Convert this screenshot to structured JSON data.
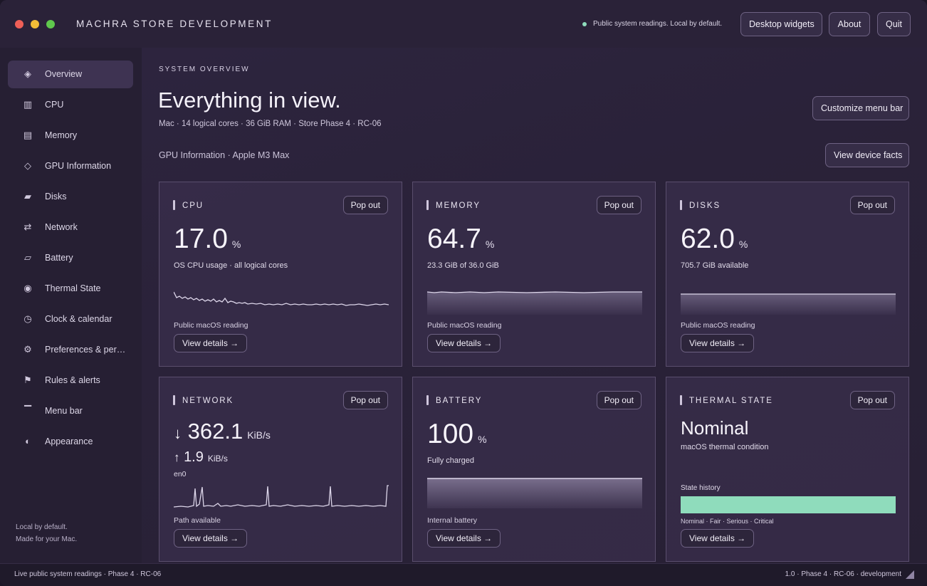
{
  "app": {
    "title": "MACHRA STORE DEVELOPMENT",
    "status": "Public system readings. Local by default.",
    "buttons": {
      "widgets": "Desktop widgets",
      "about": "About",
      "quit": "Quit"
    }
  },
  "sidebar": {
    "items": [
      {
        "label": "Overview",
        "icon": "◈"
      },
      {
        "label": "CPU",
        "icon": "▥"
      },
      {
        "label": "Memory",
        "icon": "▤"
      },
      {
        "label": "GPU Information",
        "icon": "◇"
      },
      {
        "label": "Disks",
        "icon": "▰"
      },
      {
        "label": "Network",
        "icon": "⇄"
      },
      {
        "label": "Battery",
        "icon": "▱"
      },
      {
        "label": "Thermal State",
        "icon": "◉"
      },
      {
        "label": "Clock & calendar",
        "icon": "◷"
      },
      {
        "label": "Preferences & per…",
        "icon": "⚙"
      },
      {
        "label": "Rules & alerts",
        "icon": "⚑"
      },
      {
        "label": "Menu bar",
        "icon": "▔"
      },
      {
        "label": "Appearance",
        "icon": "◐"
      }
    ],
    "footer_line1": "Local by default.",
    "footer_line2": "Made for your Mac."
  },
  "overview": {
    "eyebrow": "SYSTEM OVERVIEW",
    "headline": "Everything in view.",
    "subline": "Mac · 14 logical cores · 36 GiB RAM  ·  Store Phase 4 · RC-06",
    "gpu_line": "GPU Information · Apple M3 Max",
    "customize": "Customize menu bar",
    "device_facts": "View device facts"
  },
  "cards": {
    "popout": "Pop out",
    "details": "View details →",
    "cpu": {
      "title": "CPU",
      "value": "17.0",
      "unit": "%",
      "desc": "OS CPU usage · all logical cores",
      "foot": "Public macOS reading"
    },
    "memory": {
      "title": "MEMORY",
      "value": "64.7",
      "unit": "%",
      "desc": "23.3 GiB of 36.0 GiB",
      "foot": "Public macOS reading"
    },
    "disks": {
      "title": "DISKS",
      "value": "62.0",
      "unit": "%",
      "desc": "705.7 GiB available",
      "foot": "Public macOS reading"
    },
    "network": {
      "title": "NETWORK",
      "down_arrow": "↓",
      "down": "362.1",
      "down_unit": "KiB/s",
      "up_arrow": "↑",
      "up": "1.9",
      "up_unit": "KiB/s",
      "iface": "en0",
      "foot": "Path available"
    },
    "battery": {
      "title": "BATTERY",
      "value": "100",
      "unit": "%",
      "desc": "Fully charged",
      "foot": "Internal battery"
    },
    "thermal": {
      "title": "THERMAL STATE",
      "value": "Nominal",
      "desc": "macOS thermal condition",
      "history_label": "State history",
      "legend": "Nominal · Fair · Serious · Critical"
    }
  },
  "statusbar": {
    "left": "Live public system readings · Phase 4 · RC-06",
    "right": "1.0 · Phase 4 · RC-06 · development"
  },
  "colors": {
    "accent": "#8fdcbc",
    "panel": "#382d4a",
    "spark_line": "#ddd6ea"
  }
}
